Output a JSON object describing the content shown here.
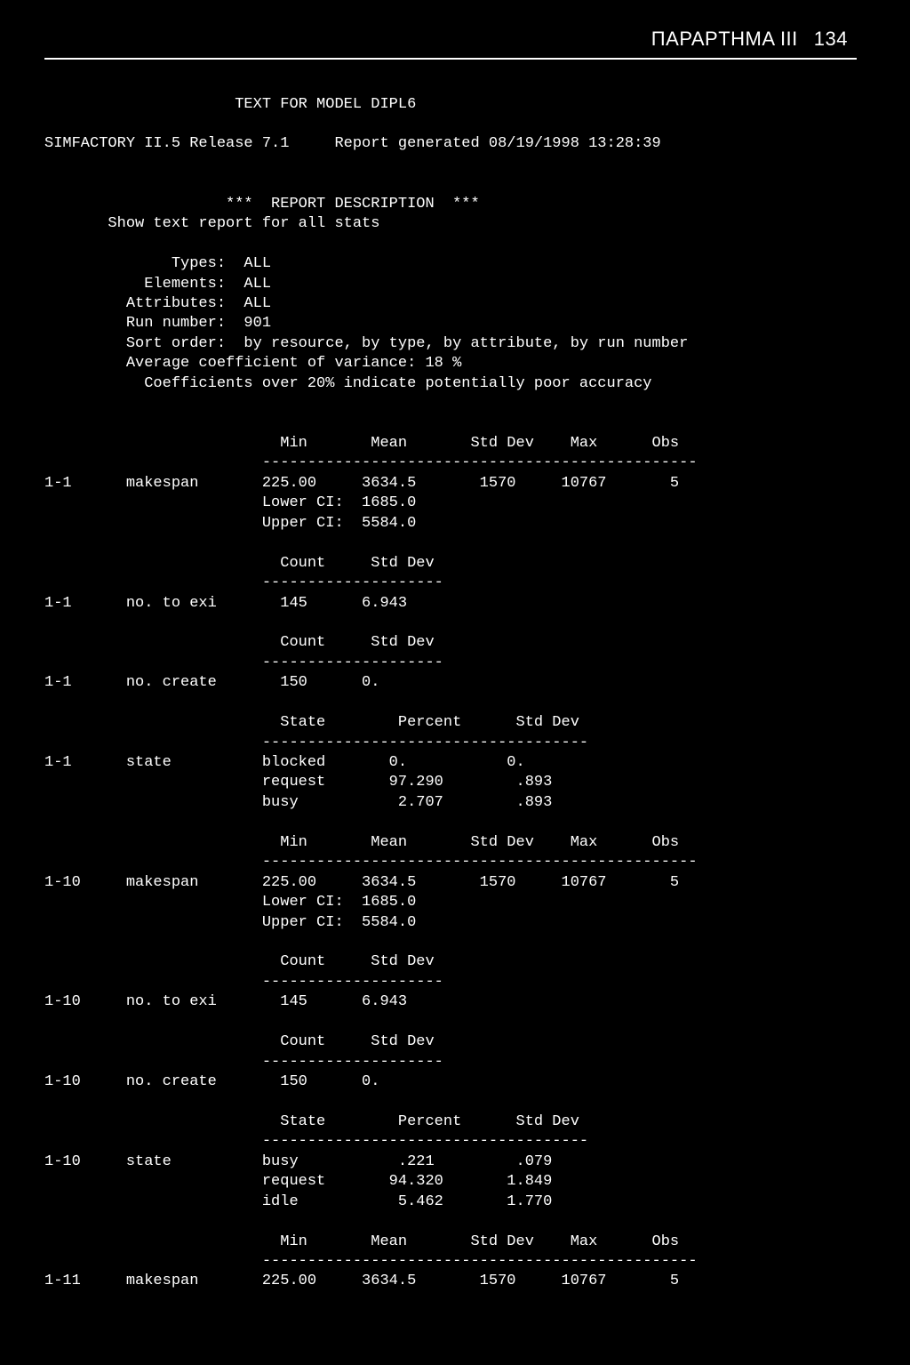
{
  "header": {
    "title": "ΠΑΡΑΡΤΗΜΑ III",
    "page": "134"
  },
  "report": {
    "model_line": "                     TEXT FOR MODEL DIPL6",
    "sim_line": "SIMFACTORY II.5 Release 7.1     Report generated 08/19/1998 13:28:39",
    "desc_hdr": "                    ***  REPORT DESCRIPTION  ***",
    "desc1": "       Show text report for all stats",
    "types": "              Types:  ALL",
    "elements": "           Elements:  ALL",
    "attributes": "         Attributes:  ALL",
    "run": "         Run number:  901",
    "sort": "         Sort order:  by resource, by type, by attribute, by run number",
    "avg": "         Average coefficient of variance: 18 %",
    "coef": "           Coefficients over 20% indicate potentially poor accuracy"
  },
  "body": {
    "l01": "                          Min       Mean       Std Dev    Max      Obs",
    "l02": "                        ------------------------------------------------",
    "l03": "1-1      makespan       225.00     3634.5       1570     10767       5",
    "l04": "                        Lower CI:  1685.0",
    "l05": "                        Upper CI:  5584.0",
    "l06": "",
    "l07": "                          Count     Std Dev",
    "l08": "                        --------------------",
    "l09": "1-1      no. to exi       145      6.943",
    "l10": "",
    "l11": "                          Count     Std Dev",
    "l12": "                        --------------------",
    "l13": "1-1      no. create       150      0.",
    "l14": "",
    "l15": "                          State        Percent      Std Dev",
    "l16": "                        ------------------------------------",
    "l17": "1-1      state          blocked       0.           0.",
    "l18": "                        request       97.290        .893",
    "l19": "                        busy           2.707        .893",
    "l20": "",
    "l21": "                          Min       Mean       Std Dev    Max      Obs",
    "l22": "                        ------------------------------------------------",
    "l23": "1-10     makespan       225.00     3634.5       1570     10767       5",
    "l24": "                        Lower CI:  1685.0",
    "l25": "                        Upper CI:  5584.0",
    "l26": "",
    "l27": "                          Count     Std Dev",
    "l28": "                        --------------------",
    "l29": "1-10     no. to exi       145      6.943",
    "l30": "",
    "l31": "                          Count     Std Dev",
    "l32": "                        --------------------",
    "l33": "1-10     no. create       150      0.",
    "l34": "",
    "l35": "                          State        Percent      Std Dev",
    "l36": "                        ------------------------------------",
    "l37": "1-10     state          busy           .221         .079",
    "l38": "                        request       94.320       1.849",
    "l39": "                        idle           5.462       1.770",
    "l40": "",
    "l41": "                          Min       Mean       Std Dev    Max      Obs",
    "l42": "                        ------------------------------------------------",
    "l43": "1-11     makespan       225.00     3634.5       1570     10767       5"
  }
}
